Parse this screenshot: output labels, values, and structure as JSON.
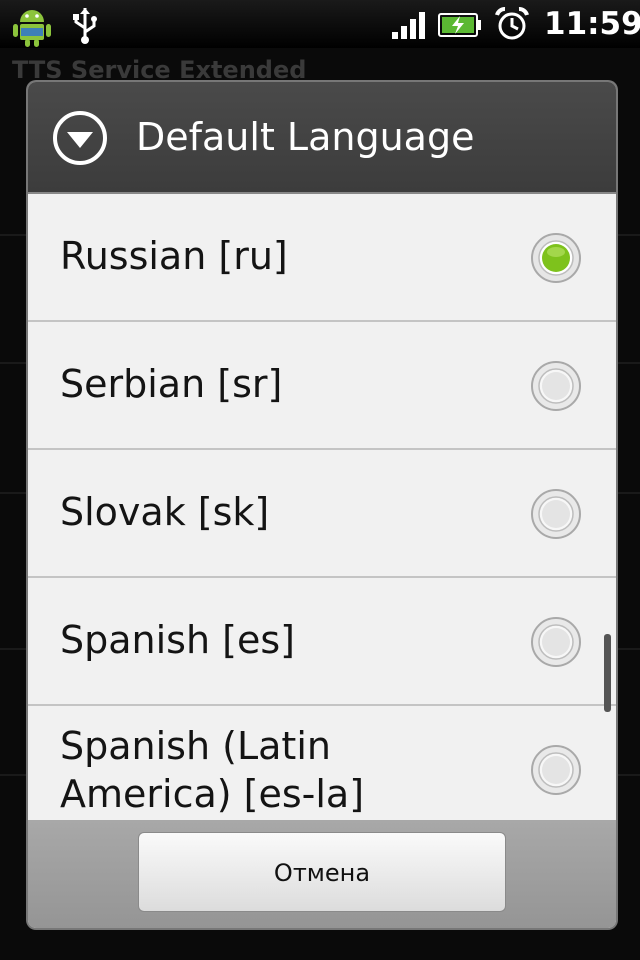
{
  "status_bar": {
    "time": "11:59",
    "icons": [
      "android-debug-icon",
      "usb-icon",
      "signal-icon",
      "battery-charging-icon",
      "alarm-clock-icon"
    ]
  },
  "background_app": {
    "title": "TTS Service Extended"
  },
  "dialog": {
    "title": "Default Language",
    "header_icon": "dropdown-circle-icon",
    "items": [
      {
        "label": "Russian [ru]",
        "selected": true
      },
      {
        "label": "Serbian [sr]",
        "selected": false
      },
      {
        "label": "Slovak [sk]",
        "selected": false
      },
      {
        "label": "Spanish [es]",
        "selected": false
      },
      {
        "label": "Spanish (Latin America) [es-la]",
        "selected": false
      }
    ],
    "cancel_label": "Отмена"
  },
  "colors": {
    "radio_selected": "#7ec21c",
    "header_bg": "#444444",
    "list_bg": "#f1f1f1"
  }
}
